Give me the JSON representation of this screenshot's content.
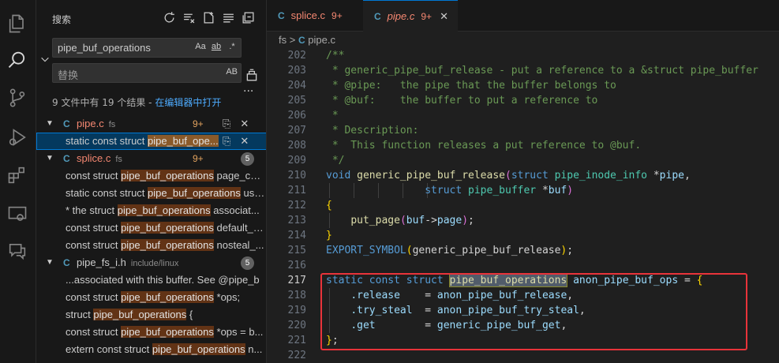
{
  "sidebar": {
    "title": "搜索",
    "search_value": "pipe_buf_operations",
    "search_opts": [
      "Aa",
      "ab",
      ".*"
    ],
    "replace_placeholder": "替换",
    "replace_opt": "AB",
    "more": "...",
    "summary_text": "9 文件中有 19 个结果 - ",
    "summary_link": "在编辑器中打开",
    "results": [
      {
        "type": "file",
        "lang": "C",
        "name": "pipe.c",
        "dir": "fs",
        "count": "9+"
      },
      {
        "type": "match",
        "pre": "static const struct ",
        "hl": "pipe_buf_ope...",
        "post": "",
        "selected": true
      },
      {
        "type": "file",
        "lang": "C",
        "name": "splice.c",
        "dir": "fs",
        "count": "9+",
        "badge": "5"
      },
      {
        "type": "match",
        "pre": "const struct ",
        "hl": "pipe_buf_operations",
        "post": " page_cac..."
      },
      {
        "type": "match",
        "pre": "static const struct ",
        "hl": "pipe_buf_operations",
        "post": " use..."
      },
      {
        "type": "match",
        "pre": "*   the struct ",
        "hl": "pipe_buf_operations",
        "post": " associat..."
      },
      {
        "type": "match",
        "pre": "const struct ",
        "hl": "pipe_buf_operations",
        "post": " default_p..."
      },
      {
        "type": "match",
        "pre": "const struct ",
        "hl": "pipe_buf_operations",
        "post": " nosteal_..."
      },
      {
        "type": "file",
        "lang": "C",
        "name": "pipe_fs_i.h",
        "dir": "include/linux",
        "count": "",
        "badge": "5"
      },
      {
        "type": "match",
        "pre": "...associated with this buffer. See @pipe_b",
        "hl": "",
        "post": ""
      },
      {
        "type": "match",
        "pre": "const struct ",
        "hl": "pipe_buf_operations",
        "post": " *ops;"
      },
      {
        "type": "match",
        "pre": "struct ",
        "hl": "pipe_buf_operations",
        "post": " {"
      },
      {
        "type": "match",
        "pre": "const struct ",
        "hl": "pipe_buf_operations",
        "post": " *ops = b..."
      },
      {
        "type": "match",
        "pre": "extern const struct ",
        "hl": "pipe_buf_operations",
        "post": " n..."
      }
    ]
  },
  "tabs": [
    {
      "lang": "C",
      "name": "splice.c",
      "count": "9+",
      "active": false
    },
    {
      "lang": "C",
      "name": "pipe.c",
      "count": "9+",
      "active": true,
      "close": "✕"
    }
  ],
  "breadcrumb": {
    "folder": "fs",
    "sep": ">",
    "lang": "C",
    "file": "pipe.c"
  },
  "code": {
    "l202": "/**",
    "l203": " * generic_pipe_buf_release - put a reference to a &struct pipe_buffer",
    "l204": " * @pipe:   the pipe that the buffer belongs to",
    "l205": " * @buf:    the buffer to put a reference to",
    "l206": " *",
    "l207": " * Description:",
    "l208": " *  This function releases a put reference to @buf.",
    "l209": " */",
    "l210a": "void",
    "l210b": "generic_pipe_buf_release",
    "l210c": "struct",
    "l210d": "pipe_inode_info",
    "l210e": "pipe",
    "l211a": "struct",
    "l211b": "pipe_buffer",
    "l211c": "buf",
    "l213a": "put_page",
    "l213b": "buf",
    "l213c": "page",
    "l215a": "EXPORT_SYMBOL",
    "l215b": "generic_pipe_buf_release",
    "l217a": "static const struct",
    "l217b": "pipe_buf_operations",
    "l217c": "anon_pipe_buf_ops",
    "l218a": ".release",
    "l218b": "anon_pipe_buf_release",
    "l219a": ".try_steal",
    "l219b": "anon_pipe_buf_try_steal",
    "l220a": ".get",
    "l220b": "generic_pipe_buf_get"
  },
  "line_numbers": [
    "202",
    "203",
    "204",
    "205",
    "206",
    "207",
    "208",
    "209",
    "210",
    "211",
    "212",
    "213",
    "214",
    "215",
    "216",
    "217",
    "218",
    "219",
    "220",
    "221",
    "222"
  ]
}
